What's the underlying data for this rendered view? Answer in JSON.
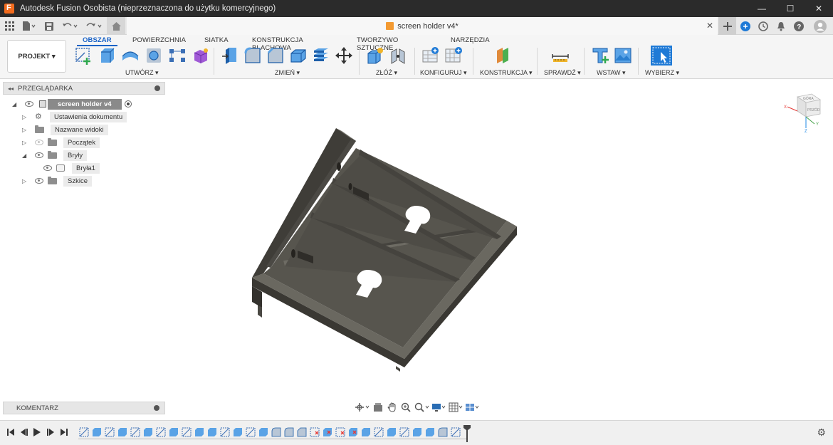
{
  "window": {
    "title": "Autodesk Fusion Osobista (nieprzeznaczona do użytku komercyjnego)",
    "controls": [
      "—",
      "☐",
      "✕"
    ]
  },
  "doc_tab": {
    "name": "screen holder v4*",
    "close": "✕"
  },
  "ribbon": {
    "projekt_label": "PROJEKT ▾",
    "tabs": [
      {
        "label": "OBSZAR",
        "active": true
      },
      {
        "label": "POWIERZCHNIA",
        "active": false
      },
      {
        "label": "SIATKA",
        "active": false
      },
      {
        "label": "KONSTRUKCJA BLACHOWA",
        "active": false
      },
      {
        "label": "TWORZYWO SZTUCZNE",
        "active": false
      },
      {
        "label": "NARZĘDZIA",
        "active": false
      }
    ],
    "groups": [
      {
        "label": "UTWÓRZ ▾"
      },
      {
        "label": "ZMIEŃ ▾"
      },
      {
        "label": "ZŁÓŻ ▾"
      },
      {
        "label": "KONFIGURUJ ▾"
      },
      {
        "label": "KONSTRUKCJA ▾"
      },
      {
        "label": "SPRAWDŹ ▾"
      },
      {
        "label": "WSTAW ▾"
      },
      {
        "label": "WYBIERZ ▾"
      }
    ]
  },
  "browser": {
    "header": "PRZEGLĄDARKA",
    "collapse_icon": "◂◂",
    "items": [
      {
        "label": "screen holder v4"
      },
      {
        "label": "Ustawienia dokumentu"
      },
      {
        "label": "Nazwane widoki"
      },
      {
        "label": "Początek"
      },
      {
        "label": "Bryły"
      },
      {
        "label": "Bryła1"
      },
      {
        "label": "Szkice"
      }
    ]
  },
  "comments": {
    "header": "KOMENTARZ"
  },
  "viewcube": {
    "top_label": "GÓRA",
    "front_label": "PRZÓD",
    "axis_x": "X",
    "axis_y": "Y",
    "axis_z": "Z"
  },
  "colors": {
    "accent": "#1a63c7",
    "model_face_top": "#5c5a52",
    "model_face_side": "#3e3c37",
    "titlebar": "#2b2b2b"
  },
  "icons": {
    "titlebar": "fusion-app-icon",
    "tabrow_left": [
      "grid-icon",
      "file-icon",
      "save-icon",
      "undo-icon",
      "redo-icon",
      "home-icon"
    ],
    "tabrow_right": [
      "plus-icon",
      "extensions-icon",
      "clock-icon",
      "bell-icon",
      "help-icon",
      "user-avatar"
    ]
  }
}
